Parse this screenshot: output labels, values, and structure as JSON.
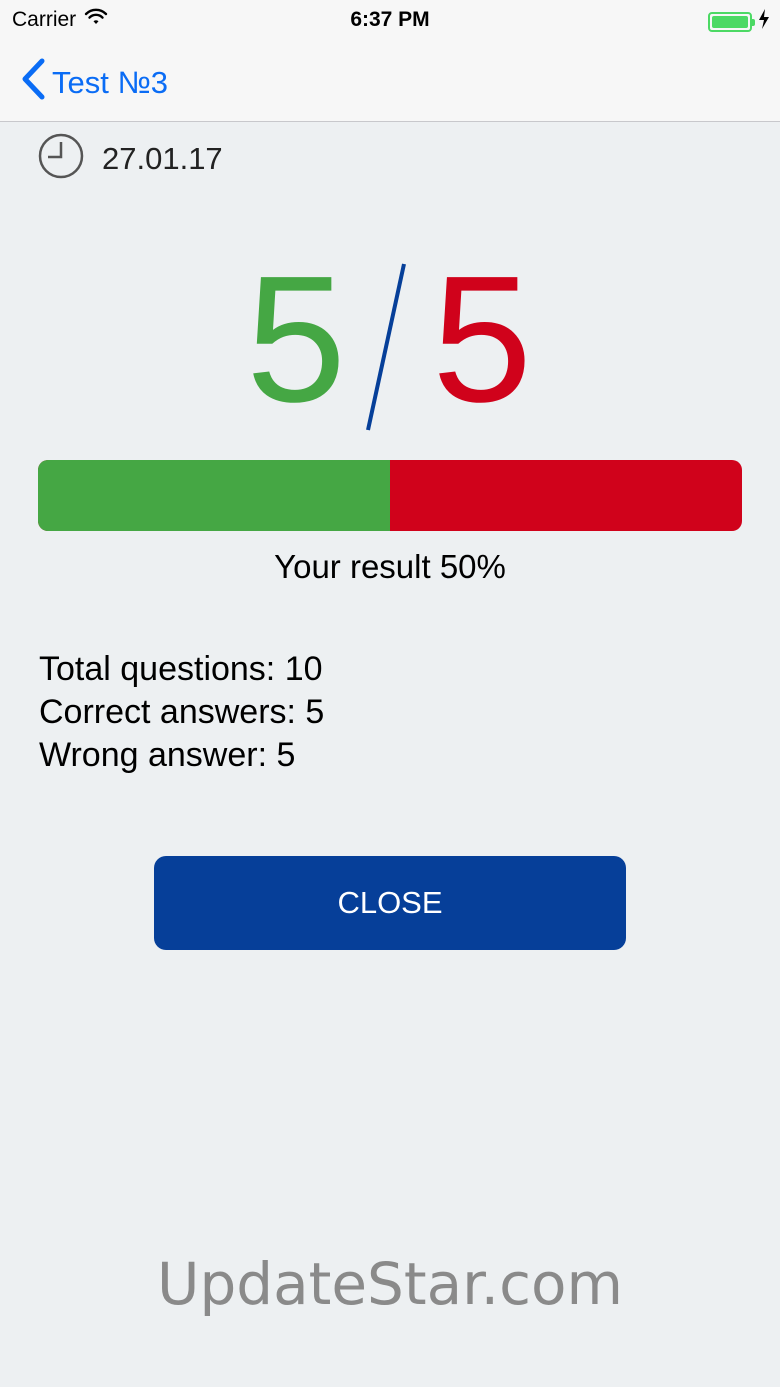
{
  "status_bar": {
    "carrier": "Carrier",
    "time": "6:37 PM"
  },
  "nav": {
    "back_label": "Test №3"
  },
  "test": {
    "date": "27.01.17",
    "correct": "5",
    "wrong": "5",
    "progress_percent": 50,
    "result_text": "Your result 50%"
  },
  "stats": {
    "total": "Total questions: 10",
    "correct": "Correct answers: 5",
    "wrong": "Wrong answer: 5"
  },
  "actions": {
    "close_label": "CLOSE"
  },
  "watermark": "UpdateStar.com",
  "colors": {
    "correct": "#45a744",
    "wrong": "#d0021b",
    "accent": "#0a6cf5",
    "button": "#063f99"
  }
}
